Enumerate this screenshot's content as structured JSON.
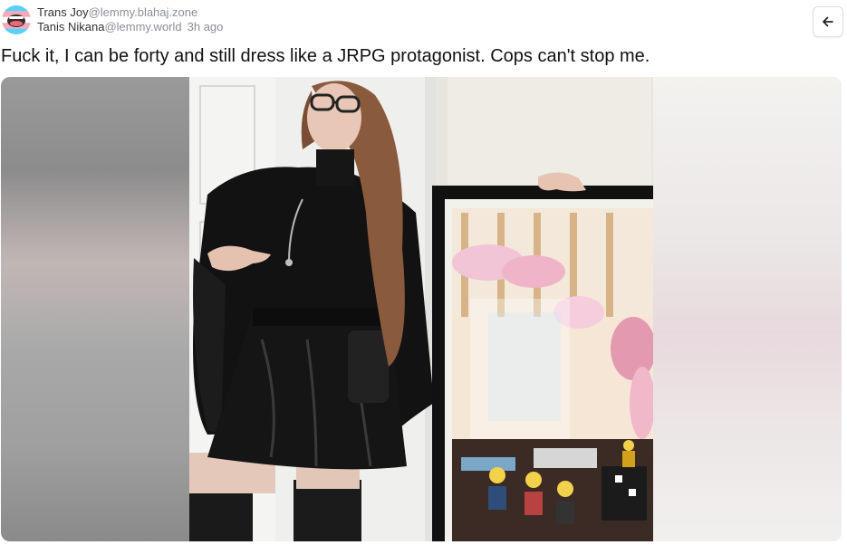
{
  "post": {
    "community_name": "Trans Joy",
    "community_instance": "@lemmy.blahaj.zone",
    "author_name": "Tanis Nikana",
    "author_instance": "@lemmy.world",
    "time_ago": "3h ago",
    "title": "Fuck it, I can be forty and still dress like a JRPG protagonist. Cops can't stop me."
  },
  "icons": {
    "avatar": "trans-flag-emoji-avatar",
    "back": "arrow-left-icon"
  },
  "colors": {
    "trans_blue": "#5BCEFA",
    "trans_pink": "#F5A9B8",
    "meta_gray": "#8a8f98"
  }
}
